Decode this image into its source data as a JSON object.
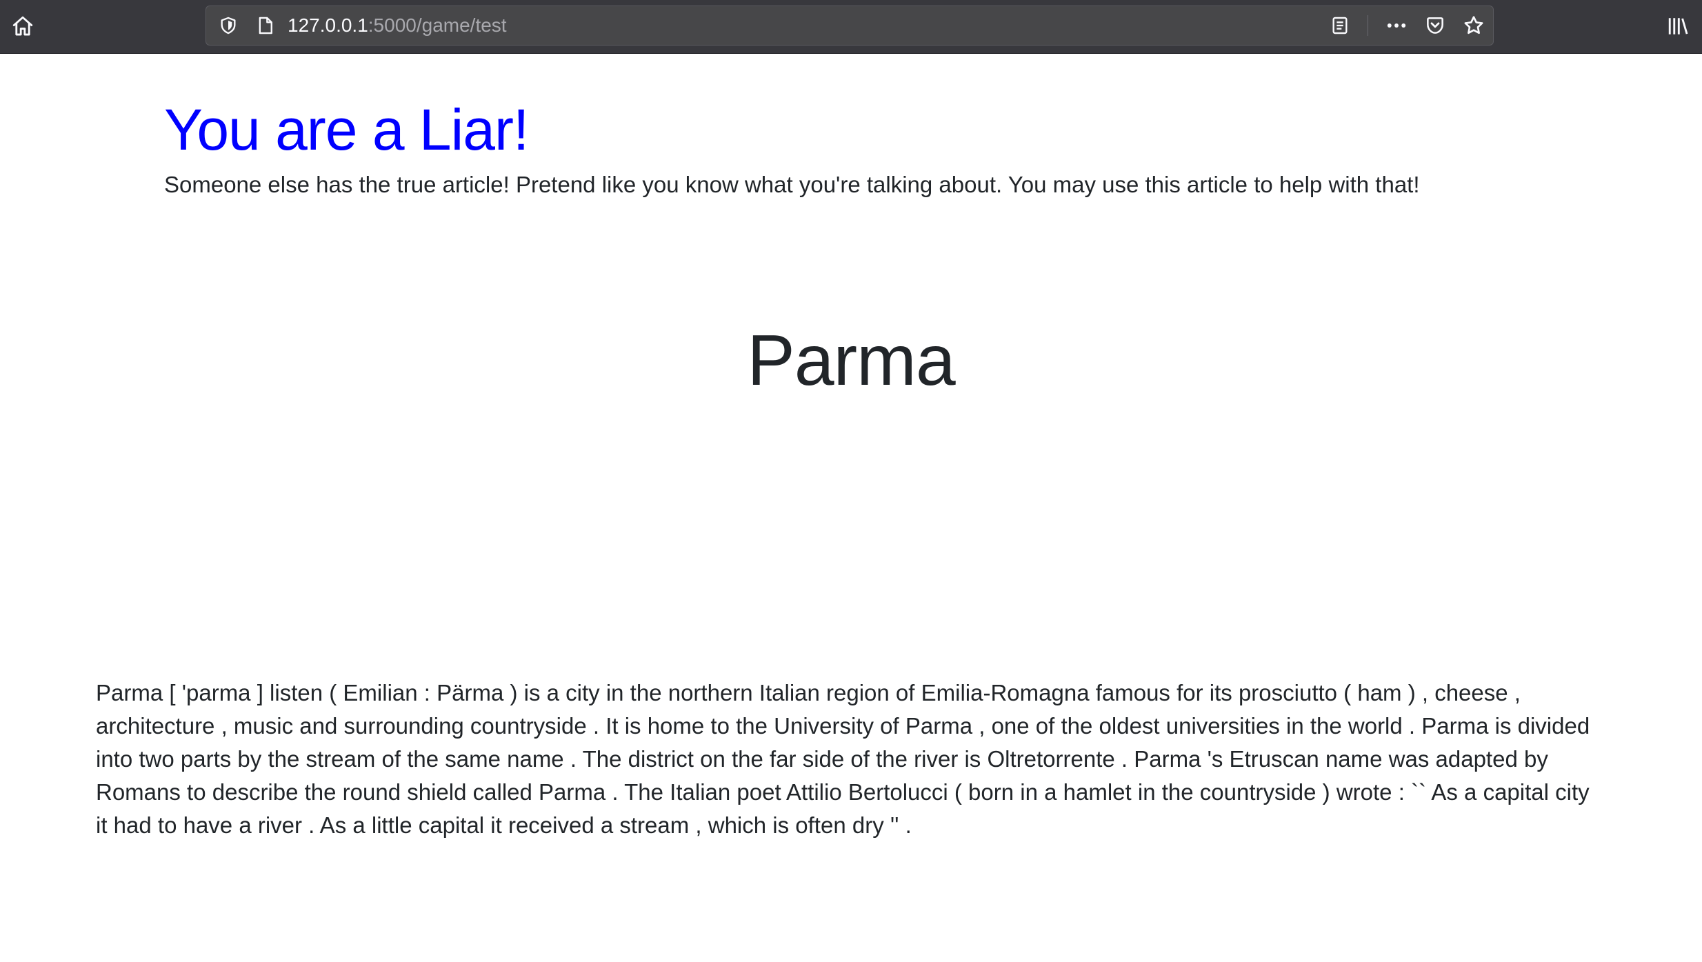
{
  "browser": {
    "url_host": "127.0.0.1",
    "url_path": ":5000/game/test",
    "icons": {
      "home": "home-icon",
      "shield": "shield-icon",
      "page": "page-icon",
      "reader": "reader-view-icon",
      "more": "more-icon",
      "pocket": "pocket-icon",
      "bookmark": "bookmark-star-icon",
      "library": "library-icon"
    },
    "colors": {
      "toolbar": "#38383d",
      "urlbar": "#474749"
    }
  },
  "page": {
    "heading": "You are a Liar!",
    "heading_color": "#0000ff",
    "subtitle": "Someone else has the true article! Pretend like you know what you're talking about. You may use this article to help with that!",
    "article_title": "Parma",
    "article_body": "Parma [ 'parma ] listen ( Emilian : Pärma ) is a city in the northern Italian region of Emilia-Romagna famous for its prosciutto ( ham ) , cheese , architecture , music and surrounding countryside . It is home to the University of Parma , one of the oldest universities in the world . Parma is divided into two parts by the stream of the same name . The district on the far side of the river is Oltretorrente . Parma 's Etruscan name was adapted by Romans to describe the round shield called Parma . The Italian poet Attilio Bertolucci ( born in a hamlet in the countryside ) wrote : `` As a capital city it had to have a river . As a little capital it received a stream , which is often dry '' ."
  }
}
